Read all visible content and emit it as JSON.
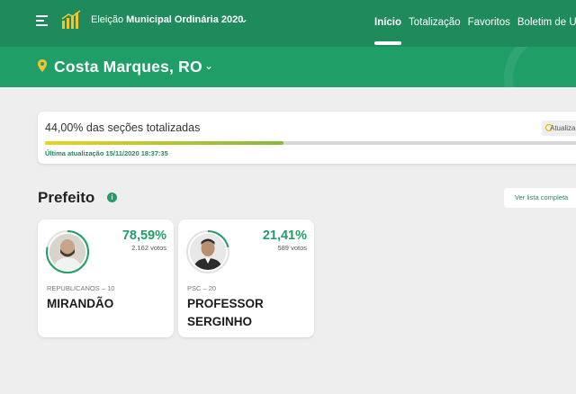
{
  "header": {
    "election_prefix": "Eleição",
    "election_bold": "Municipal Ordinária 2020",
    "nav": [
      "Início",
      "Totalização",
      "Favoritos",
      "Boletim de Urna"
    ]
  },
  "city": {
    "name": "Costa Marques, RO"
  },
  "progress": {
    "title": "44,00% das seções totalizadas",
    "fraction": 0.44,
    "last_update": "Última atualização 15/11/2020 18:37:35",
    "update_label": "Atualizar"
  },
  "section": {
    "title": "Prefeito",
    "info": "i",
    "full_list": "Ver lista completa"
  },
  "candidates": [
    {
      "percent": "78,59%",
      "votes": "2.162 votos",
      "party": "REPUBLICANOS – 10",
      "name": "MIRANDÃO",
      "share": 0.7859
    },
    {
      "percent": "21,41%",
      "votes": "589 votos",
      "party": "PSC – 20",
      "name": "PROFESSOR SERGINHO",
      "share": 0.2141
    }
  ],
  "colors": {
    "primary": "#1f8a5c",
    "secondary": "#1f9e68",
    "progress_yellow": "#e9d321"
  }
}
